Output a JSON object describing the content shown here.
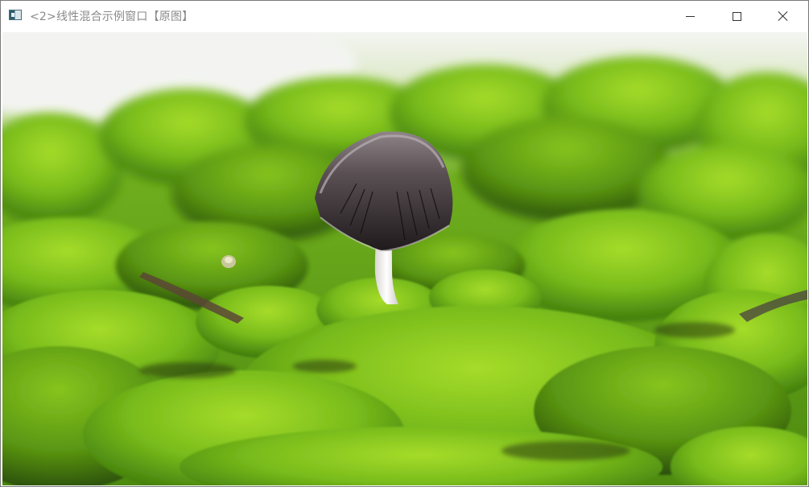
{
  "window": {
    "title": "<2>线性混合示例窗口【原图】",
    "controls": {
      "minimize_icon": "minimize-icon",
      "maximize_icon": "maximize-icon",
      "close_icon": "close-icon"
    }
  },
  "image": {
    "subject_icon": "mushroom-on-moss-photo",
    "colors": {
      "sky": "#eef0ec",
      "moss_bright": "#8ccc1c",
      "moss_mid": "#5d9e14",
      "moss_dark": "#2f5a0a",
      "mushroom_cap": "#3a3334",
      "mushroom_rim": "#cfc6c8",
      "stem": "#f2f0ee"
    }
  }
}
